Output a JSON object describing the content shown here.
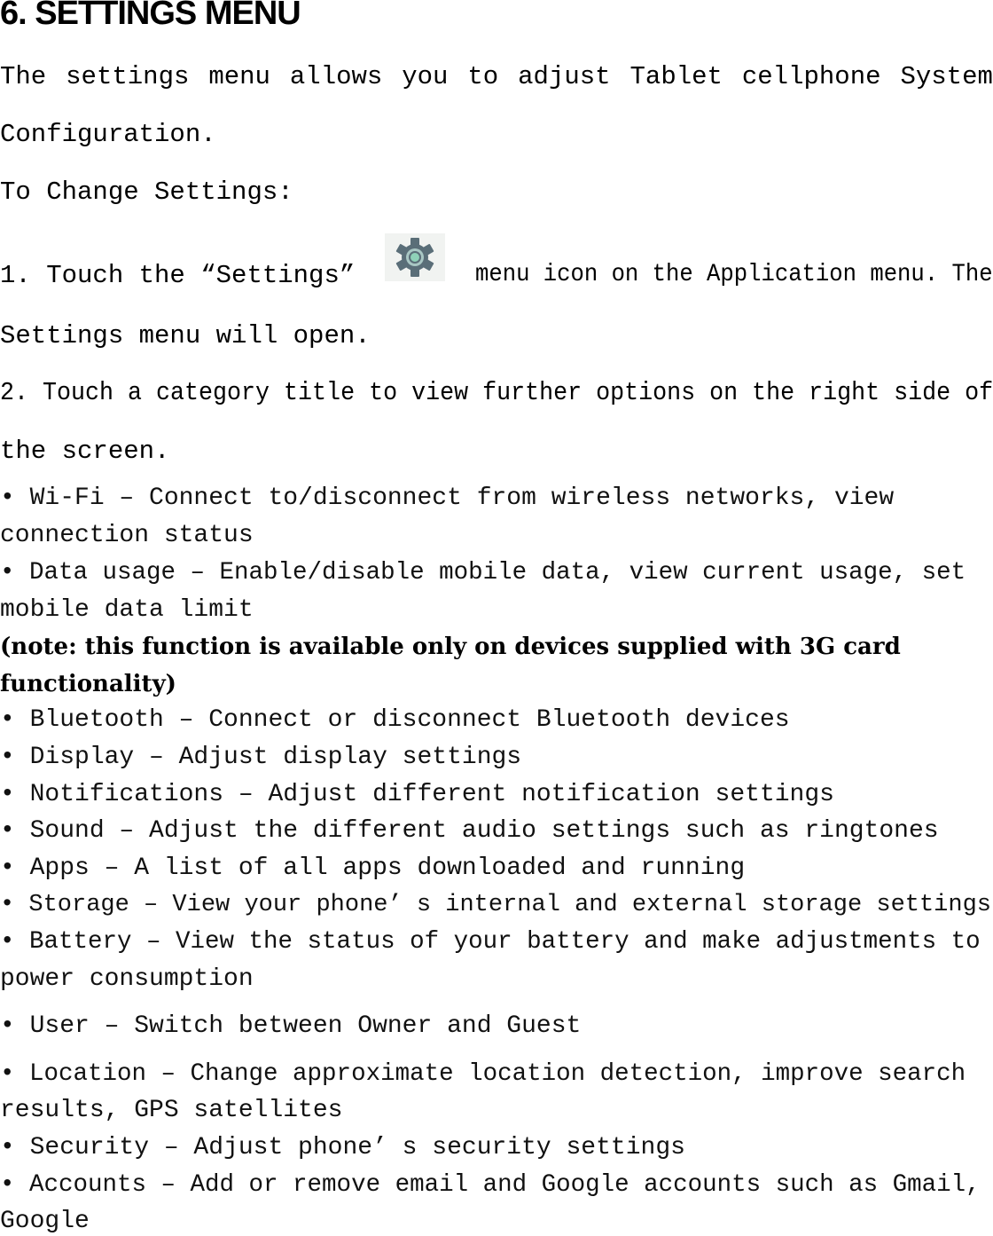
{
  "heading": "6. SETTINGS MENU",
  "intro": {
    "line1_words": [
      "The",
      "settings",
      "menu",
      "allows",
      "you",
      "to",
      "adjust",
      "Tablet",
      "cellphone",
      "System"
    ],
    "line2": "Configuration.",
    "change_label": "To Change Settings:"
  },
  "steps": [
    {
      "before_icon": "1. Touch the “Settings”",
      "icon": "settings-gear-icon",
      "after_icon": "menu icon on the Application menu. The",
      "continuation": "Settings menu will open."
    },
    {
      "text": "2. Touch a category title to view further options on the right side of",
      "continuation": "the screen."
    }
  ],
  "colors": {
    "gear_body": "#5a6e78",
    "gear_ring": "#a9c7c4",
    "gear_center": "#8fd1b8",
    "icon_bg": "#f1f3f1"
  },
  "items": [
    {
      "line1": "• Wi-Fi  –  Connect to/disconnect from wireless networks,  view",
      "line2": "connection status"
    },
    {
      "line1": "• Data usage  –  Enable/disable mobile data,  view current usage,  set",
      "line2": "mobile data limit"
    },
    {
      "note1": "(note: this function is available only on devices supplied with 3G card",
      "note2": "functionality)"
    },
    {
      "line1": "• Bluetooth  –  Connect or disconnect Bluetooth devices"
    },
    {
      "line1": "• Display  –  Adjust display settings"
    },
    {
      "line1": "• Notifications  –  Adjust different notification settings"
    },
    {
      "line1": "• Sound  –  Adjust the different audio settings such as ringtones"
    },
    {
      "line1": "• Apps  –  A list of all apps downloaded and running"
    },
    {
      "line1": "• Storage – View your phone’ s internal and external storage settings"
    },
    {
      "line1": "• Battery  –  View the status of your battery and make adjustments to",
      "line2": "power consumption"
    },
    {
      "line1": "• User – Switch between Owner and Guest"
    },
    {
      "line1": "• Location  –  Change approximate location detection,  improve search",
      "line2": "results,  GPS satellites"
    },
    {
      "line1": "• Security  –  Adjust phone’ s security settings"
    },
    {
      "line1": "• Accounts  –  Add or remove email and Google accounts such as Gmail,",
      "line2": "Google"
    }
  ]
}
